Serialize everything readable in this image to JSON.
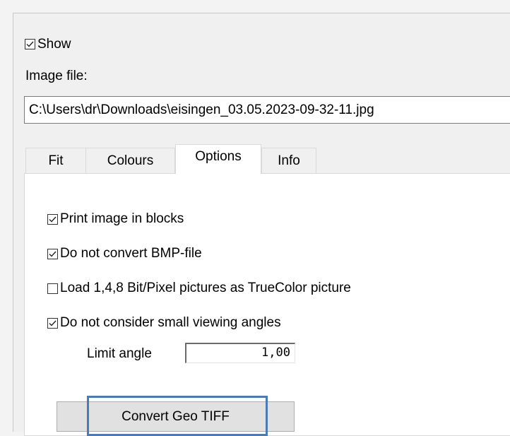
{
  "show": {
    "label": "Show",
    "checked": true
  },
  "image_file": {
    "label": "Image file:",
    "value": "C:\\Users\\dr\\Downloads\\eisingen_03.05.2023-09-32-11.jpg"
  },
  "tabs": [
    {
      "label": "Fit",
      "active": false
    },
    {
      "label": "Colours",
      "active": false
    },
    {
      "label": "Options",
      "active": true
    },
    {
      "label": "Info",
      "active": false
    }
  ],
  "options": {
    "checkboxes": [
      {
        "label": "Print image in blocks",
        "checked": true
      },
      {
        "label": "Do not convert BMP-file",
        "checked": true
      },
      {
        "label": "Load 1,4,8 Bit/Pixel pictures as TrueColor picture",
        "checked": false
      },
      {
        "label": "Do not consider small viewing angles",
        "checked": true
      }
    ],
    "limit_angle": {
      "label": "Limit angle",
      "value": "1,00"
    },
    "convert_button": {
      "label": "Convert Geo TIFF"
    }
  },
  "colors": {
    "highlight": "#4a7bb7",
    "button_face": "#e1e1e1"
  }
}
